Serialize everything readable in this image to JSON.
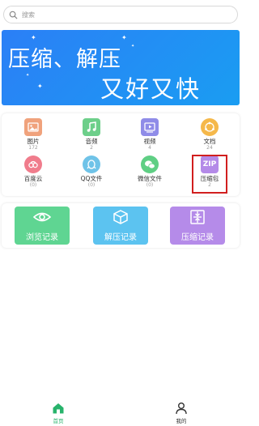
{
  "search": {
    "placeholder": "搜索"
  },
  "banner": {
    "line1": "压缩、解压",
    "line2": "又好又快",
    "color": "#2b7ff6"
  },
  "categories": [
    {
      "label": "图片",
      "count": "172",
      "icon": "image-icon",
      "color": "#f0a27c"
    },
    {
      "label": "音频",
      "count": "2",
      "icon": "music-icon",
      "color": "#6dcf8a"
    },
    {
      "label": "视频",
      "count": "4",
      "icon": "video-icon",
      "color": "#8f8ce8"
    },
    {
      "label": "文档",
      "count": "24",
      "icon": "document-icon",
      "color": "#f5b84a"
    },
    {
      "label": "百度云",
      "count": "(0)",
      "icon": "baidu-cloud-icon",
      "color": "#f07c8c"
    },
    {
      "label": "QQ文件",
      "count": "(0)",
      "icon": "qq-icon",
      "color": "#6fc3e8"
    },
    {
      "label": "微信文件",
      "count": "(0)",
      "icon": "wechat-icon",
      "color": "#5fcf84"
    },
    {
      "label": "压缩包",
      "count": "2",
      "icon": "zip-icon",
      "icon_text": "ZIP",
      "color": "#b48ae8"
    }
  ],
  "records": [
    {
      "label": "浏览记录",
      "icon": "eye-icon",
      "color": "#5fd592"
    },
    {
      "label": "解压记录",
      "icon": "box-icon",
      "color": "#5cc3f0"
    },
    {
      "label": "压缩记录",
      "icon": "compress-icon",
      "color": "#b58be9"
    }
  ],
  "nav": [
    {
      "label": "首页",
      "icon": "home-icon",
      "active": true,
      "color": "#27b36b"
    },
    {
      "label": "我的",
      "icon": "user-icon",
      "active": false,
      "color": "#333333"
    }
  ]
}
